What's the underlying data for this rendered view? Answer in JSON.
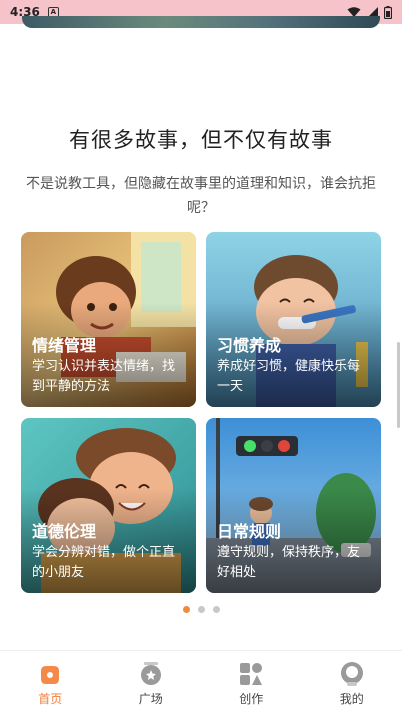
{
  "status_bar": {
    "time": "4:36",
    "notification_glyph": "A"
  },
  "section": {
    "title": "有很多故事，但不仅有故事",
    "description": "不是说教工具，但隐藏在故事里的道理和知识，谁会抗拒呢？"
  },
  "cards": [
    {
      "title": "情绪管理",
      "desc": "学习认识并表达情绪，找到平静的方法"
    },
    {
      "title": "习惯养成",
      "desc": "养成好习惯，健康快乐每一天"
    },
    {
      "title": "道德伦理",
      "desc": "学会分辨对错，做个正直的小朋友"
    },
    {
      "title": "日常规则",
      "desc": "遵守规则，保持秩序，友好相处"
    }
  ],
  "pagination": {
    "total": 3,
    "active": 1
  },
  "tabbar": {
    "items": [
      {
        "label": "首页",
        "icon": "home-icon",
        "active": true
      },
      {
        "label": "广场",
        "icon": "square-icon",
        "active": false
      },
      {
        "label": "创作",
        "icon": "create-icon",
        "active": false
      },
      {
        "label": "我的",
        "icon": "profile-icon",
        "active": false
      }
    ]
  },
  "colors": {
    "accent": "#f07e3a",
    "status_bar": "#f6c3cb"
  }
}
